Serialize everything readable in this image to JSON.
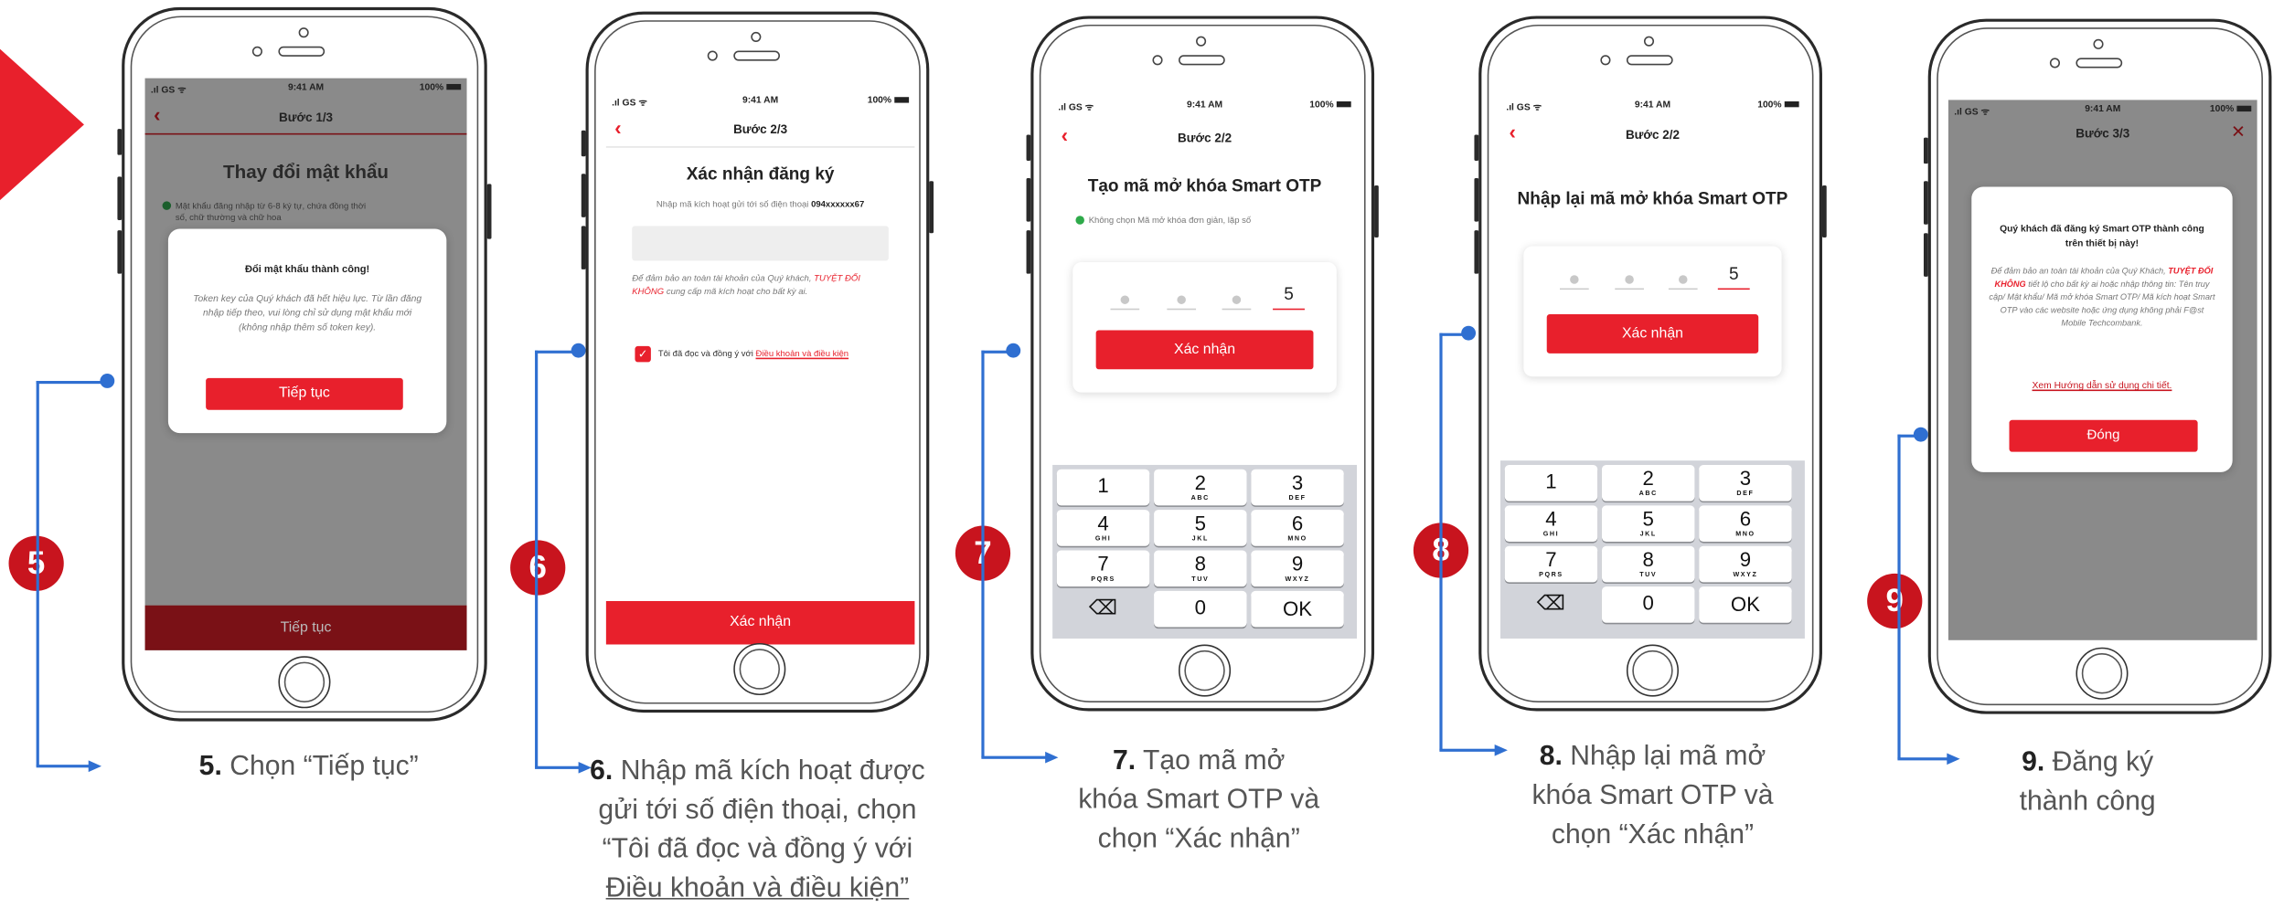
{
  "colors": {
    "accent": "#e8202c",
    "connector": "#2f6fd1",
    "step_circle": "#c8141e"
  },
  "status": {
    "carrier": "GS",
    "time": "9:41 AM",
    "battery": "100%"
  },
  "s5": {
    "nav_title": "Bước 1/3",
    "heading": "Thay đổi mật khẩu",
    "bg_rule1": "Mật khẩu đăng nhập từ 6-8 ký tự, chứa đồng thời",
    "bg_rule1b": "số, chữ thường và chữ hoa",
    "modal_title": "Đổi mật khẩu thành công!",
    "modal_body": "Token key của Quý khách đã hết hiệu lực. Từ lần đăng nhập tiếp theo, vui lòng chỉ sử dụng mật khẩu mới (không nhập thêm số token key).",
    "modal_button": "Tiếp tục",
    "bottom_button": "Tiếp tục"
  },
  "s6": {
    "nav_title": "Bước 2/3",
    "heading": "Xác nhận đăng ký",
    "hint_prefix": "Nhập mã kích hoạt gửi tới số điện thoại",
    "phone": "094xxxxxx67",
    "warning_prefix": "Để đảm bảo an toàn tài khoản của Quý khách,",
    "warning_red": "TUYỆT ĐỐI KHÔNG",
    "warning_suffix": "cung cấp mã kích hoạt cho bất kỳ ai.",
    "agree_prefix": "Tôi đã đọc và đồng ý với",
    "agree_link": "Điều khoản và điều kiện",
    "button": "Xác nhận"
  },
  "s7": {
    "nav_title": "Bước 2/2",
    "heading": "Tạo mã mở khóa Smart OTP",
    "rule": "Không chọn Mã mở khóa đơn giản, lặp số",
    "pin_last": "5",
    "button": "Xác nhận"
  },
  "s8": {
    "nav_title": "Bước 2/2",
    "heading": "Nhập lại mã mở khóa Smart OTP",
    "pin_last": "5",
    "button": "Xác nhận"
  },
  "s9": {
    "nav_title": "Bước 3/3",
    "close": "✕",
    "modal_title": "Quý khách đã đăng ký Smart OTP thành công trên thiết bị này!",
    "body_prefix": "Để đảm bảo an toàn tài khoản của Quý Khách,",
    "body_red": "TUYỆT ĐỐI KHÔNG",
    "body_suffix": "tiết lộ cho bất kỳ ai hoặc nhập thông tin: Tên truy cập/ Mật khẩu/ Mã mở khóa Smart OTP/ Mã kích hoạt Smart OTP vào các website hoặc ứng dụng không phải F@st Mobile Techcombank.",
    "guide_link": "Xem Hướng dẫn sử dụng chi tiết.",
    "button": "Đóng"
  },
  "keypad": [
    {
      "n": "1",
      "s": ""
    },
    {
      "n": "2",
      "s": "ABC"
    },
    {
      "n": "3",
      "s": "DEF"
    },
    {
      "n": "4",
      "s": "GHI"
    },
    {
      "n": "5",
      "s": "JKL"
    },
    {
      "n": "6",
      "s": "MNO"
    },
    {
      "n": "7",
      "s": "PQRS"
    },
    {
      "n": "8",
      "s": "TUV"
    },
    {
      "n": "9",
      "s": "WXYZ"
    },
    {
      "n": "⌫",
      "s": ""
    },
    {
      "n": "0",
      "s": ""
    },
    {
      "n": "OK",
      "s": ""
    }
  ],
  "steps": {
    "n5": "5",
    "n6": "6",
    "n7": "7",
    "n8": "8",
    "n9": "9",
    "c5_num": "5.",
    "c5_text": "Chọn “Tiếp tục”",
    "c6_num": "6.",
    "c6_l1": "Nhập mã kích hoạt được",
    "c6_l2": "gửi tới số điện thoại, chọn",
    "c6_l3": "“Tôi đã đọc và đồng ý với",
    "c6_l4": "Điều khoản và điều kiện”",
    "c7_num": "7.",
    "c7_l1": "Tạo mã mở",
    "c7_l2": "khóa Smart OTP và",
    "c7_l3": "chọn “Xác nhận”",
    "c8_num": "8.",
    "c8_l1": "Nhập lại mã mở",
    "c8_l2": "khóa Smart OTP và",
    "c8_l3": "chọn “Xác nhận”",
    "c9_num": "9.",
    "c9_l1": "Đăng ký",
    "c9_l2": "thành công"
  }
}
